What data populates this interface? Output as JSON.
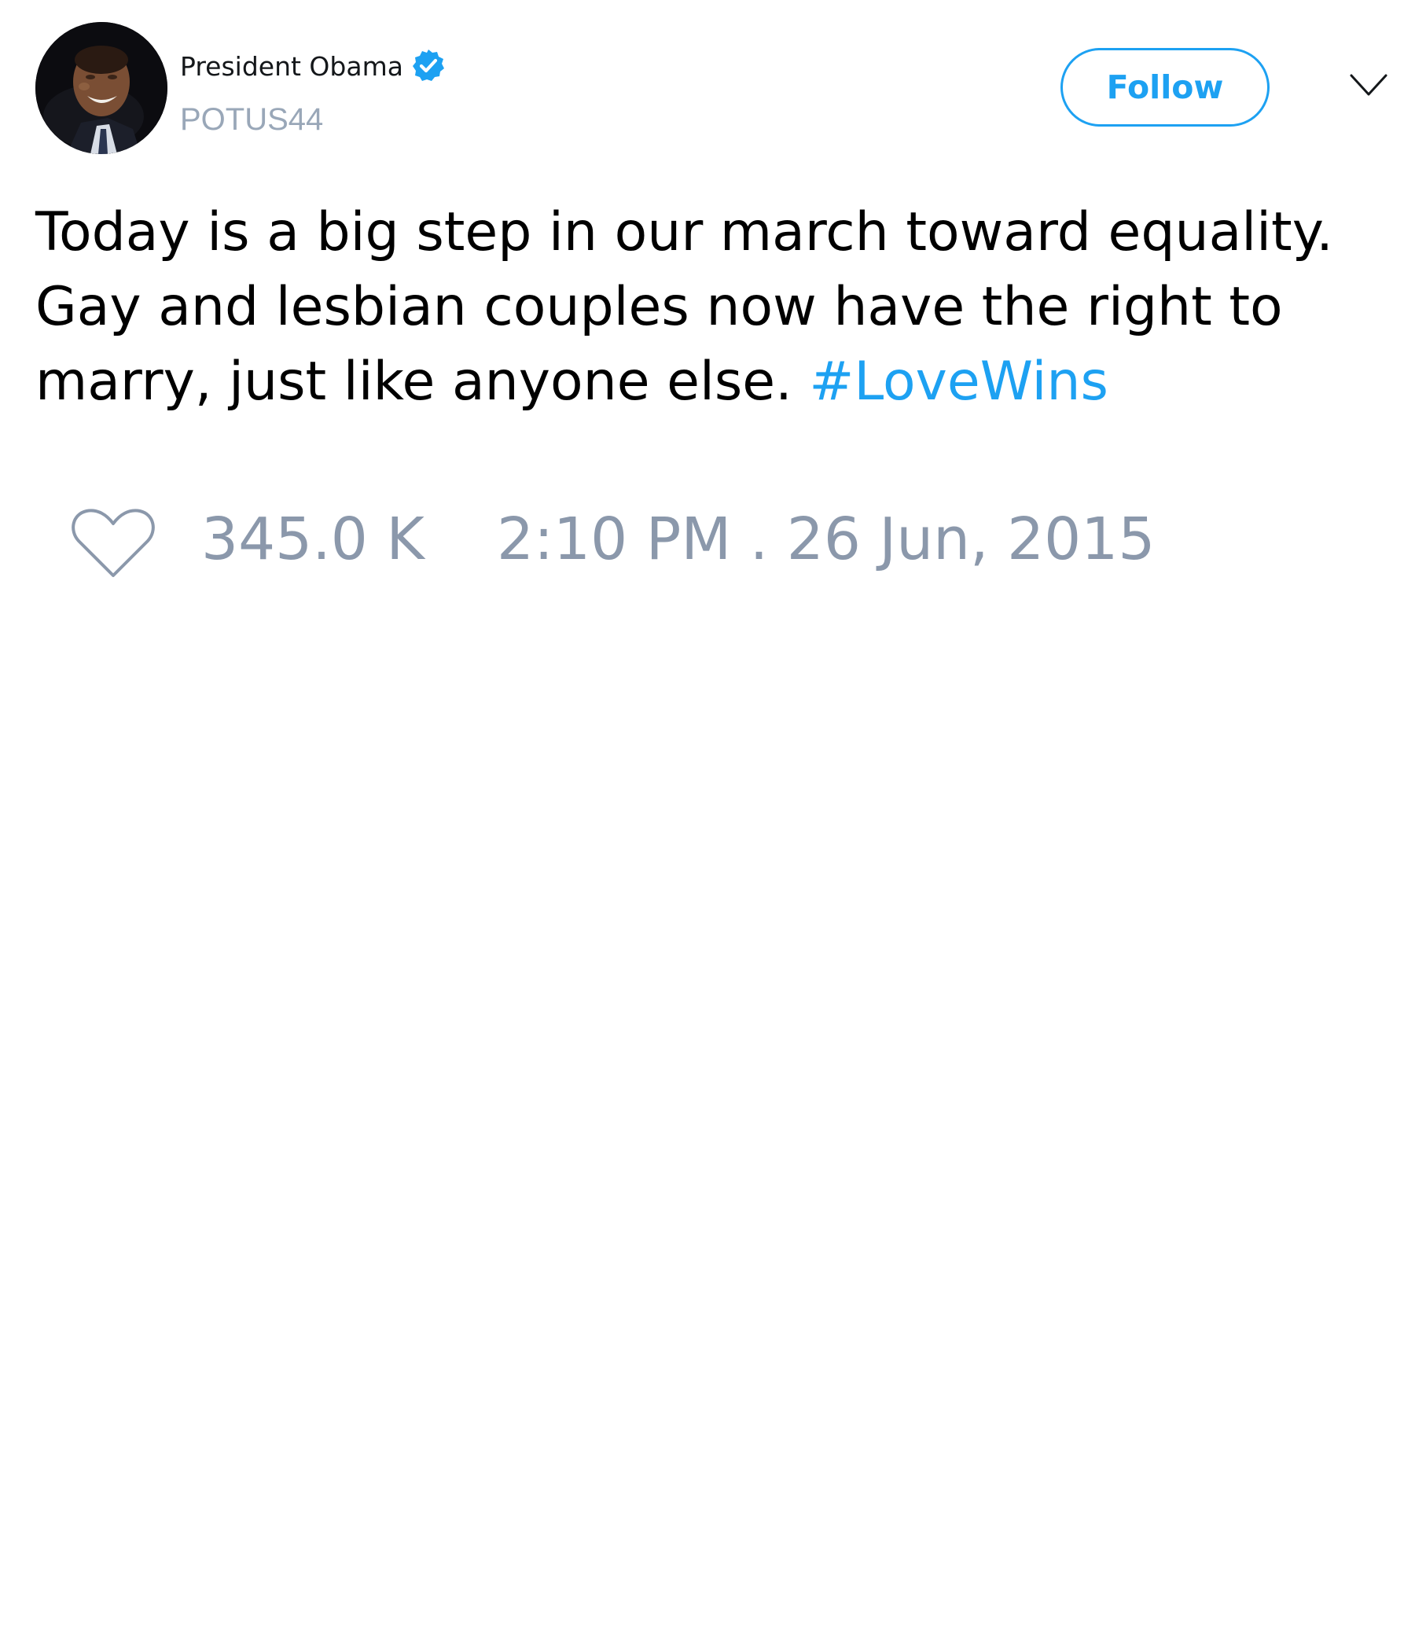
{
  "tweet": {
    "author": {
      "display_name": "President Obama",
      "handle": "POTUS44",
      "verified": true,
      "avatar_icon": "portrait-avatar"
    },
    "follow_label": "Follow",
    "menu_icon": "chevron-down-icon",
    "text": {
      "body": "Today is a big step in our march toward equality. Gay and lesbian couples now have the right to marry, just like anyone else. ",
      "hashtag": "#LoveWins"
    },
    "likes": "345.0 K",
    "timestamp": "2:10 PM . 26 Jun, 2015"
  },
  "colors": {
    "accent": "#1da1f2",
    "text": "#000000",
    "muted": "#8b98ab",
    "handle": "#99a7b8"
  },
  "icons": {
    "like": "heart-outline-icon",
    "verified": "verified-badge-icon"
  }
}
